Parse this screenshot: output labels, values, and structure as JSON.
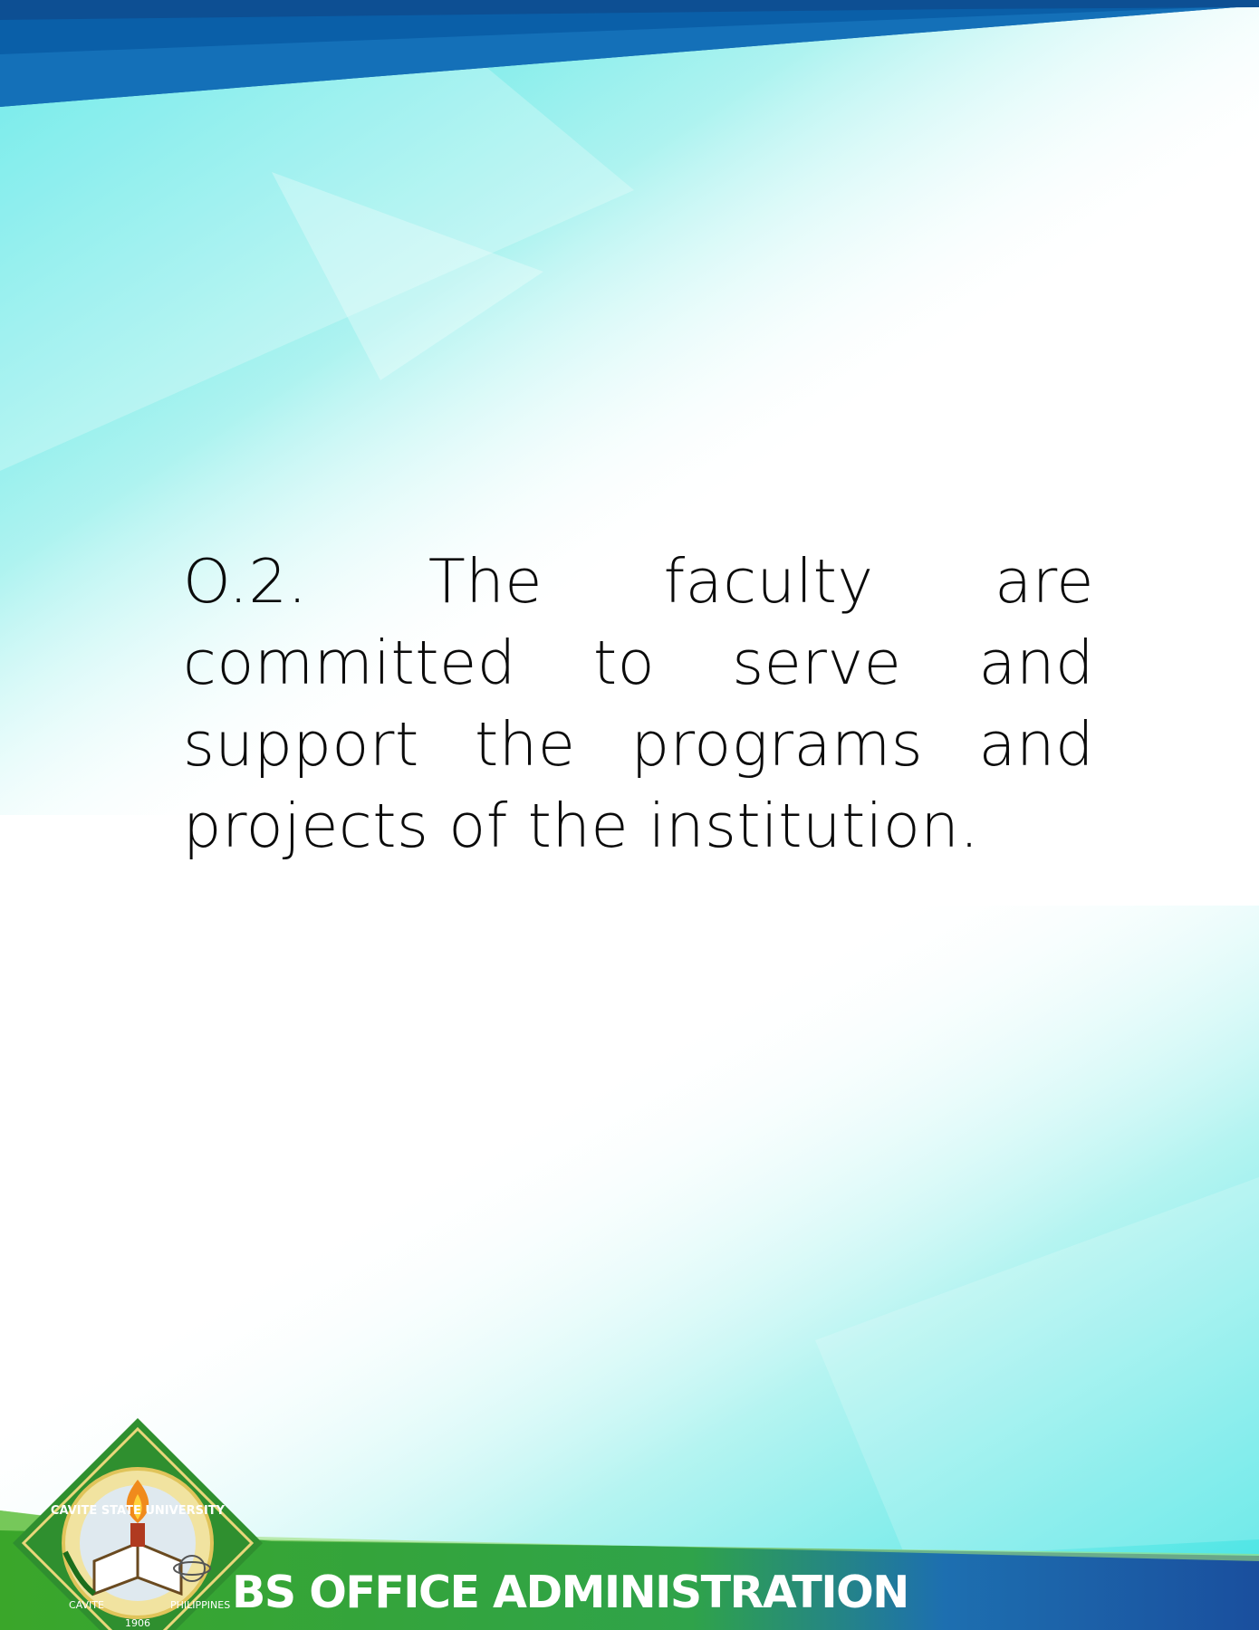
{
  "body": {
    "paragraph": "O.2. The faculty are committed to serve and support the programs and projects of the institution."
  },
  "footer": {
    "title": "BS OFFICE ADMINISTRATION"
  },
  "seal": {
    "arc_top": "CAVITE STATE UNIVERSITY",
    "left_text": "CAVITE",
    "right_text": "PHILIPPINES",
    "year": "1906"
  },
  "colors": {
    "header_blue": "#0a5fa8",
    "cyan": "#4fe6e6",
    "footer_green": "#3aa62a",
    "footer_blue": "#1a4f9e",
    "seal_green": "#2f8f2f"
  }
}
